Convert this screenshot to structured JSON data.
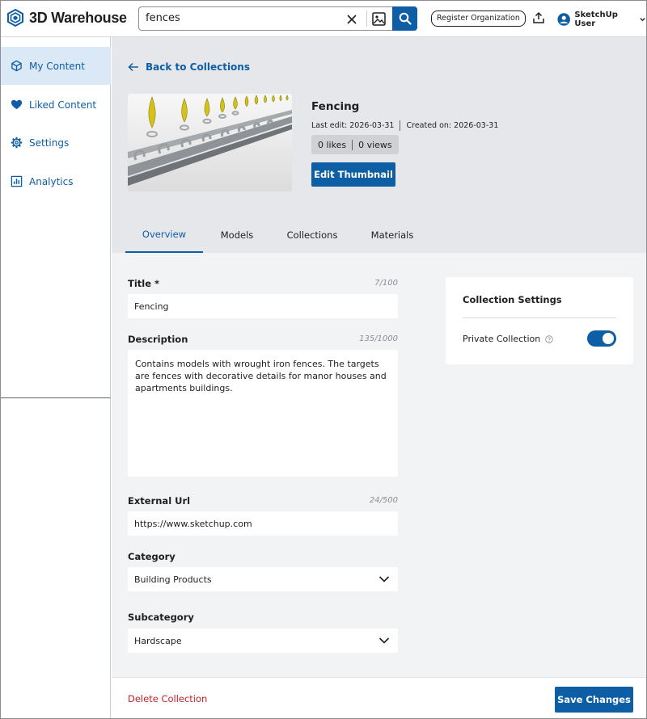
{
  "header": {
    "brand": "3D Warehouse",
    "search": {
      "value": "fences"
    },
    "register_label": "Register Organization",
    "user_name": "SketchUp User"
  },
  "sidebar": {
    "items": [
      {
        "label": "My Content",
        "icon": "cube-icon",
        "active": true
      },
      {
        "label": "Liked Content",
        "icon": "heart-icon"
      },
      {
        "label": "Settings",
        "icon": "gear-icon"
      },
      {
        "label": "Analytics",
        "icon": "bar-chart-icon"
      }
    ]
  },
  "collection": {
    "back_label": "Back to Collections",
    "title": "Fencing",
    "last_edit": "Last edit: 2026-03-31",
    "created_on": "Created on: 2026-03-31",
    "likes": "0 likes",
    "views": "0 views",
    "edit_thumbnail_label": "Edit Thumbnail"
  },
  "tabs": [
    {
      "label": "Overview",
      "active": true
    },
    {
      "label": "Models"
    },
    {
      "label": "Collections"
    },
    {
      "label": "Materials"
    }
  ],
  "form": {
    "title": {
      "label": "Title *",
      "count": "7/100",
      "value": "Fencing"
    },
    "description": {
      "label": "Description",
      "count": "135/1000",
      "value": "Contains models with wrought iron fences. The targets are fences with decorative details for manor houses and apartments buildings."
    },
    "external_url": {
      "label": "External Url",
      "count": "24/500",
      "value": "https://www.sketchup.com"
    },
    "category": {
      "label": "Category",
      "value": "Building Products"
    },
    "subcategory": {
      "label": "Subcategory",
      "value": "Hardscape"
    }
  },
  "settings": {
    "title": "Collection Settings",
    "private_label": "Private Collection",
    "private_enabled": true
  },
  "footer": {
    "delete_label": "Delete Collection",
    "save_label": "Save Changes"
  },
  "colors": {
    "primary": "#0e5ea5",
    "danger": "#c8202a",
    "sidebar_active": "#dbe9f7",
    "header_band": "#e6e7ea",
    "content_bg": "#f2f3f5",
    "fence_spike": "#d4c21a"
  }
}
